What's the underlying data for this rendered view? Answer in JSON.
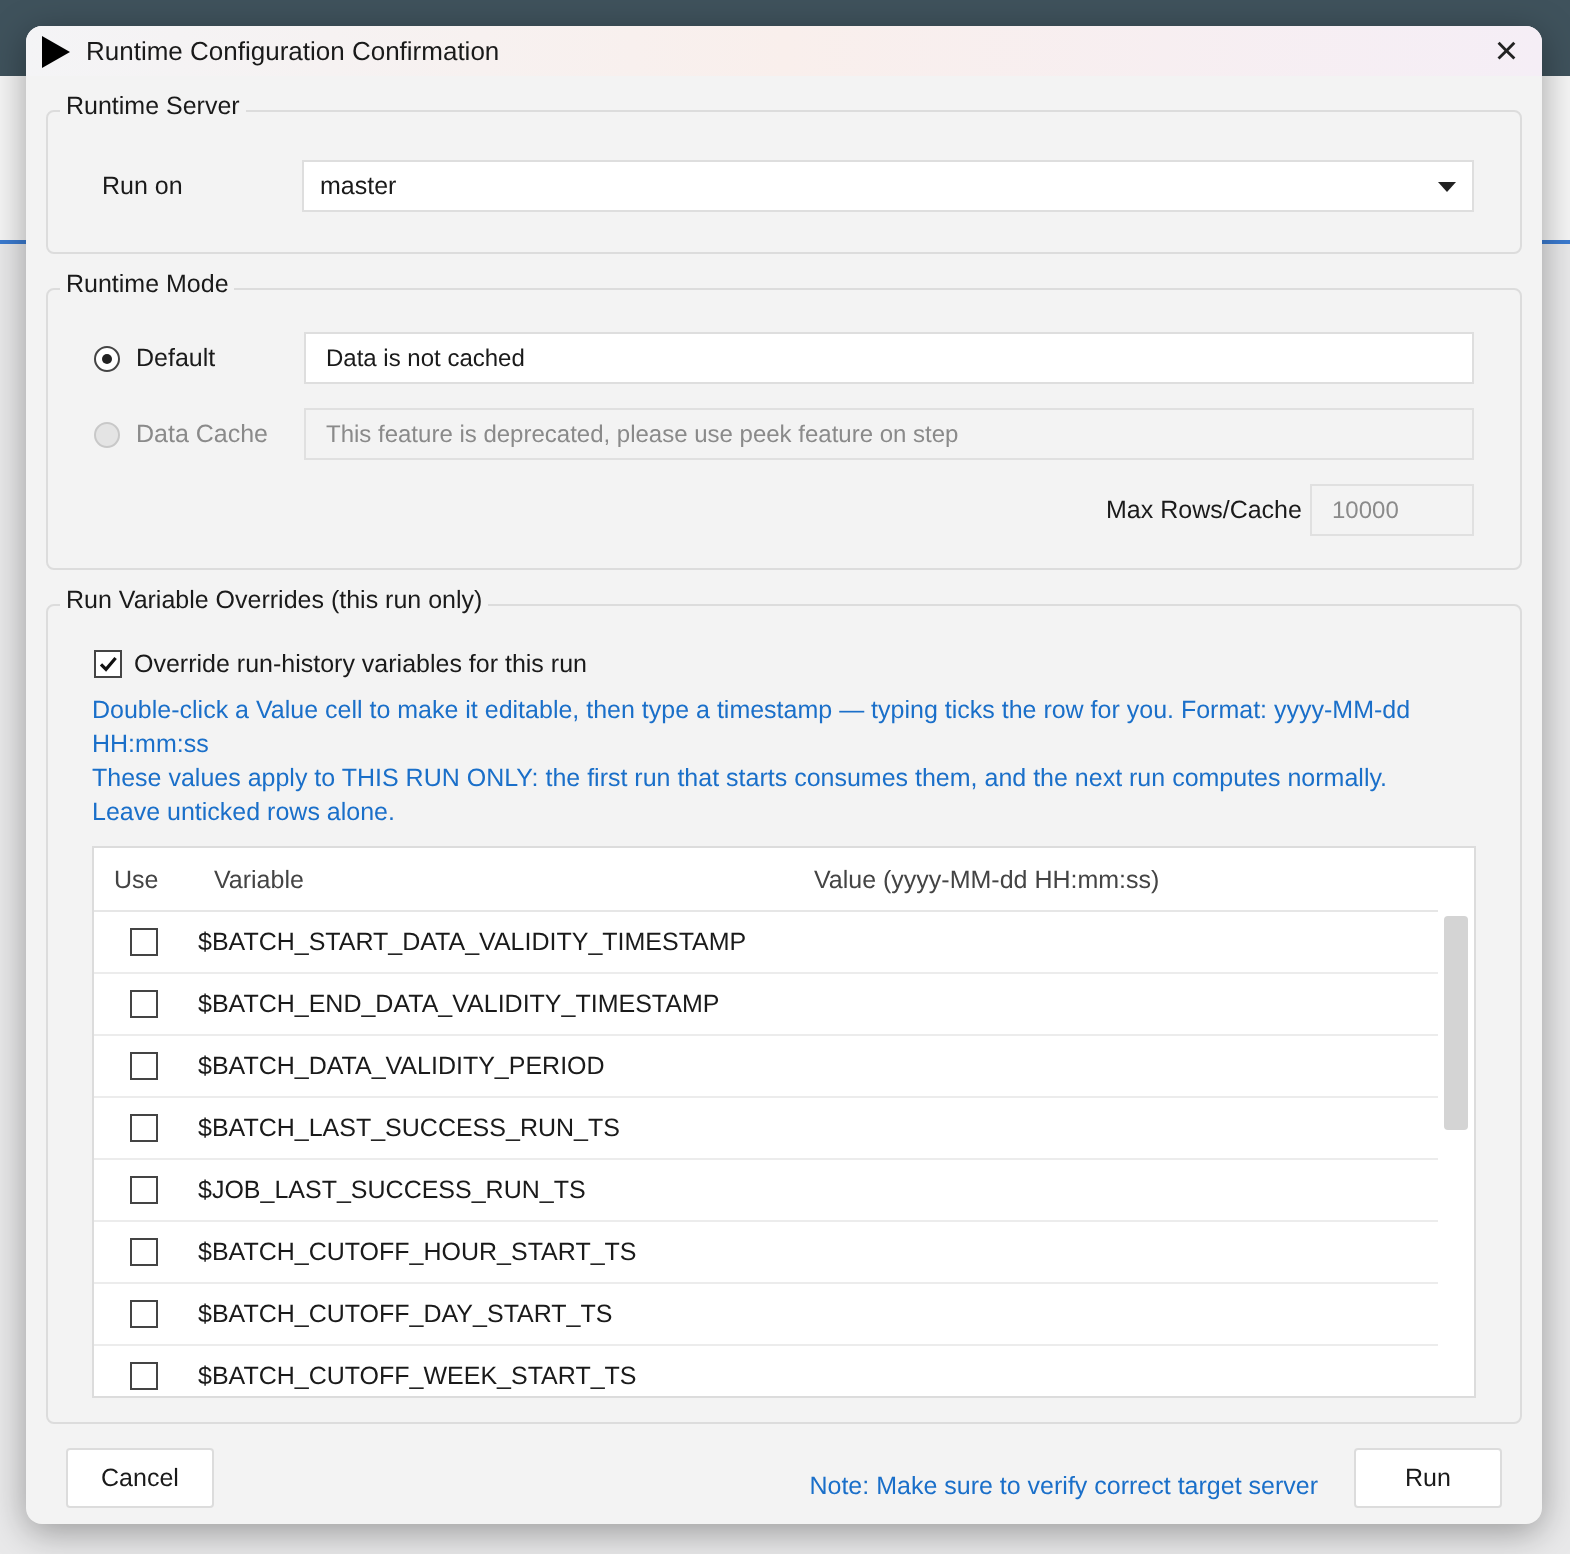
{
  "dialog": {
    "title": "Runtime Configuration Confirmation",
    "close": "×"
  },
  "runtime_server": {
    "legend": "Runtime Server",
    "label": "Run on",
    "value": "master"
  },
  "runtime_mode": {
    "legend": "Runtime Mode",
    "options": [
      {
        "label": "Default",
        "selected": true,
        "disabled": false,
        "field": "Data is not cached"
      },
      {
        "label": "Data Cache",
        "selected": false,
        "disabled": true,
        "field": "This feature is deprecated, please use peek feature on step"
      }
    ],
    "max_rows": {
      "label": "Max Rows/Cache",
      "value": "10000",
      "disabled": true
    }
  },
  "overrides": {
    "legend": "Run Variable Overrides (this run only)",
    "checkbox": {
      "label": "Override run-history variables for this run",
      "checked": true
    },
    "help": [
      "Double-click a Value cell to make it editable, then type a timestamp — typing ticks the row for you. Format: yyyy-MM-dd HH:mm:ss",
      "These values apply to THIS RUN ONLY: the first run that starts consumes them, and the next run computes normally. Leave unticked rows alone."
    ],
    "table": {
      "columns": [
        "Use",
        "Variable",
        "Value (yyyy-MM-dd HH:mm:ss)"
      ],
      "rows": [
        {
          "variable": "$BATCH_START_DATA_VALIDITY_TIMESTAMP",
          "checked": false
        },
        {
          "variable": "$BATCH_END_DATA_VALIDITY_TIMESTAMP",
          "checked": false
        },
        {
          "variable": "$BATCH_DATA_VALIDITY_PERIOD",
          "checked": false
        },
        {
          "variable": "$BATCH_LAST_SUCCESS_RUN_TS",
          "checked": false
        },
        {
          "variable": "$JOB_LAST_SUCCESS_RUN_TS",
          "checked": false
        },
        {
          "variable": "$BATCH_CUTOFF_HOUR_START_TS",
          "checked": false
        },
        {
          "variable": "$BATCH_CUTOFF_DAY_START_TS",
          "checked": false
        },
        {
          "variable": "$BATCH_CUTOFF_WEEK_START_TS",
          "checked": false
        }
      ]
    }
  },
  "footer": {
    "cancel": "Cancel",
    "note": "Note: Make sure to verify correct target server",
    "run": "Run"
  }
}
